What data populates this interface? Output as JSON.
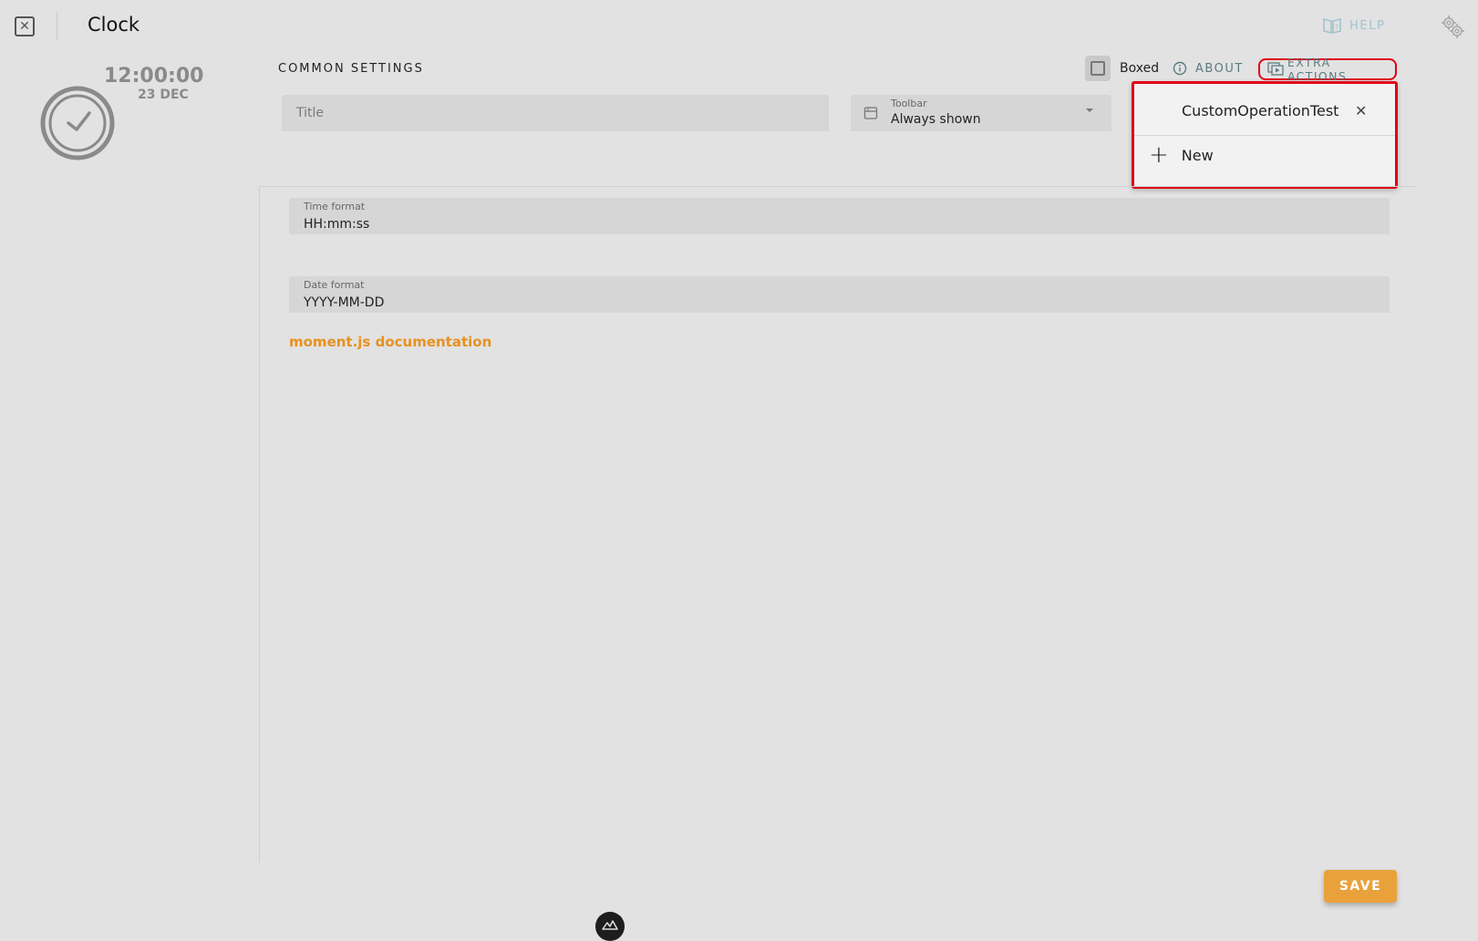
{
  "header": {
    "title": "Clock",
    "help_label": "HELP",
    "help_icon": "book-question-icon",
    "settings_icon": "gears-icon"
  },
  "preview": {
    "time": "12:00:00",
    "date": "23 DEC",
    "icon": "clock-icon"
  },
  "common_settings": {
    "title": "COMMON SETTINGS",
    "boxed_label": "Boxed",
    "boxed_checked": false,
    "about_label": "ABOUT",
    "extra_actions_label": "EXTRA ACTIONS",
    "title_placeholder": "Title",
    "toolbar": {
      "label": "Toolbar",
      "value": "Always shown"
    }
  },
  "extra_actions_menu": {
    "items": [
      {
        "label": "CustomOperationTest"
      }
    ],
    "new_label": "New"
  },
  "fields": {
    "time_format": {
      "label": "Time format",
      "value": "HH:mm:ss"
    },
    "date_format": {
      "label": "Date format",
      "value": "YYYY-MM-DD"
    }
  },
  "doc_link": "moment.js documentation",
  "save_label": "SAVE",
  "colors": {
    "accent": "#e8911f",
    "save": "#e9a23b",
    "highlight": "#e0001a",
    "background": "#e2e2e2"
  }
}
